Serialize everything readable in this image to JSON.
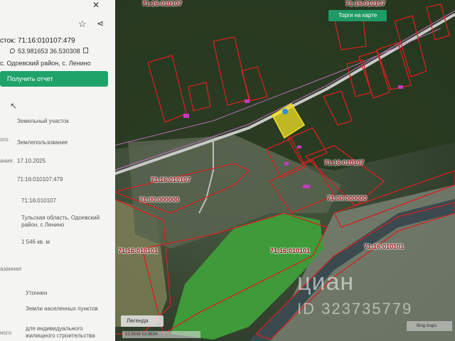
{
  "panel": {
    "title": "сток: 71:16:010107:479",
    "coords": "53.981653 36.530308",
    "address": "с. Одоевский район, с. Ленино",
    "report_button": "Получить отчет",
    "fields": [
      {
        "label": "",
        "value": "Земельный участок"
      },
      {
        "label": "ого",
        "value": "Землепользование"
      },
      {
        "label": "ания",
        "value": "17.10.2025"
      },
      {
        "label": "",
        "value": "71:16:010107:479"
      },
      {
        "label": "",
        "value": "71:16:010107"
      },
      {
        "label": "",
        "value": "Тульская область, Одоевский район, с Ленино"
      },
      {
        "label": "",
        "value": "1 546 кв. м"
      },
      {
        "label": "азанная",
        "value": ""
      },
      {
        "label": "",
        "value": "Уточнен"
      },
      {
        "label": "",
        "value": "Земли населенных пунктов"
      },
      {
        "label": "ного",
        "value": "для индивидуального жилищного строительства"
      }
    ]
  },
  "map": {
    "torgi_button": "Торги на карте",
    "legend_button": "Легенда",
    "status_left": "53.5548  53.9834",
    "status_right": "Bing maps",
    "watermark": "циан",
    "watermark_id": "ID 323735779",
    "cadastral_labels": [
      "71:16:010107",
      "71:16:010107",
      "71:16:010107",
      "71:16:010107",
      "71:00:000000",
      "71:00:000000",
      "71:16:010101",
      "71:16:010101",
      "71:16:010101"
    ]
  },
  "colors": {
    "accent": "#20a36b",
    "parcel_outline": "#d62020",
    "selected_parcel": "#f2e224",
    "cadastral_text": "#8a1010"
  }
}
